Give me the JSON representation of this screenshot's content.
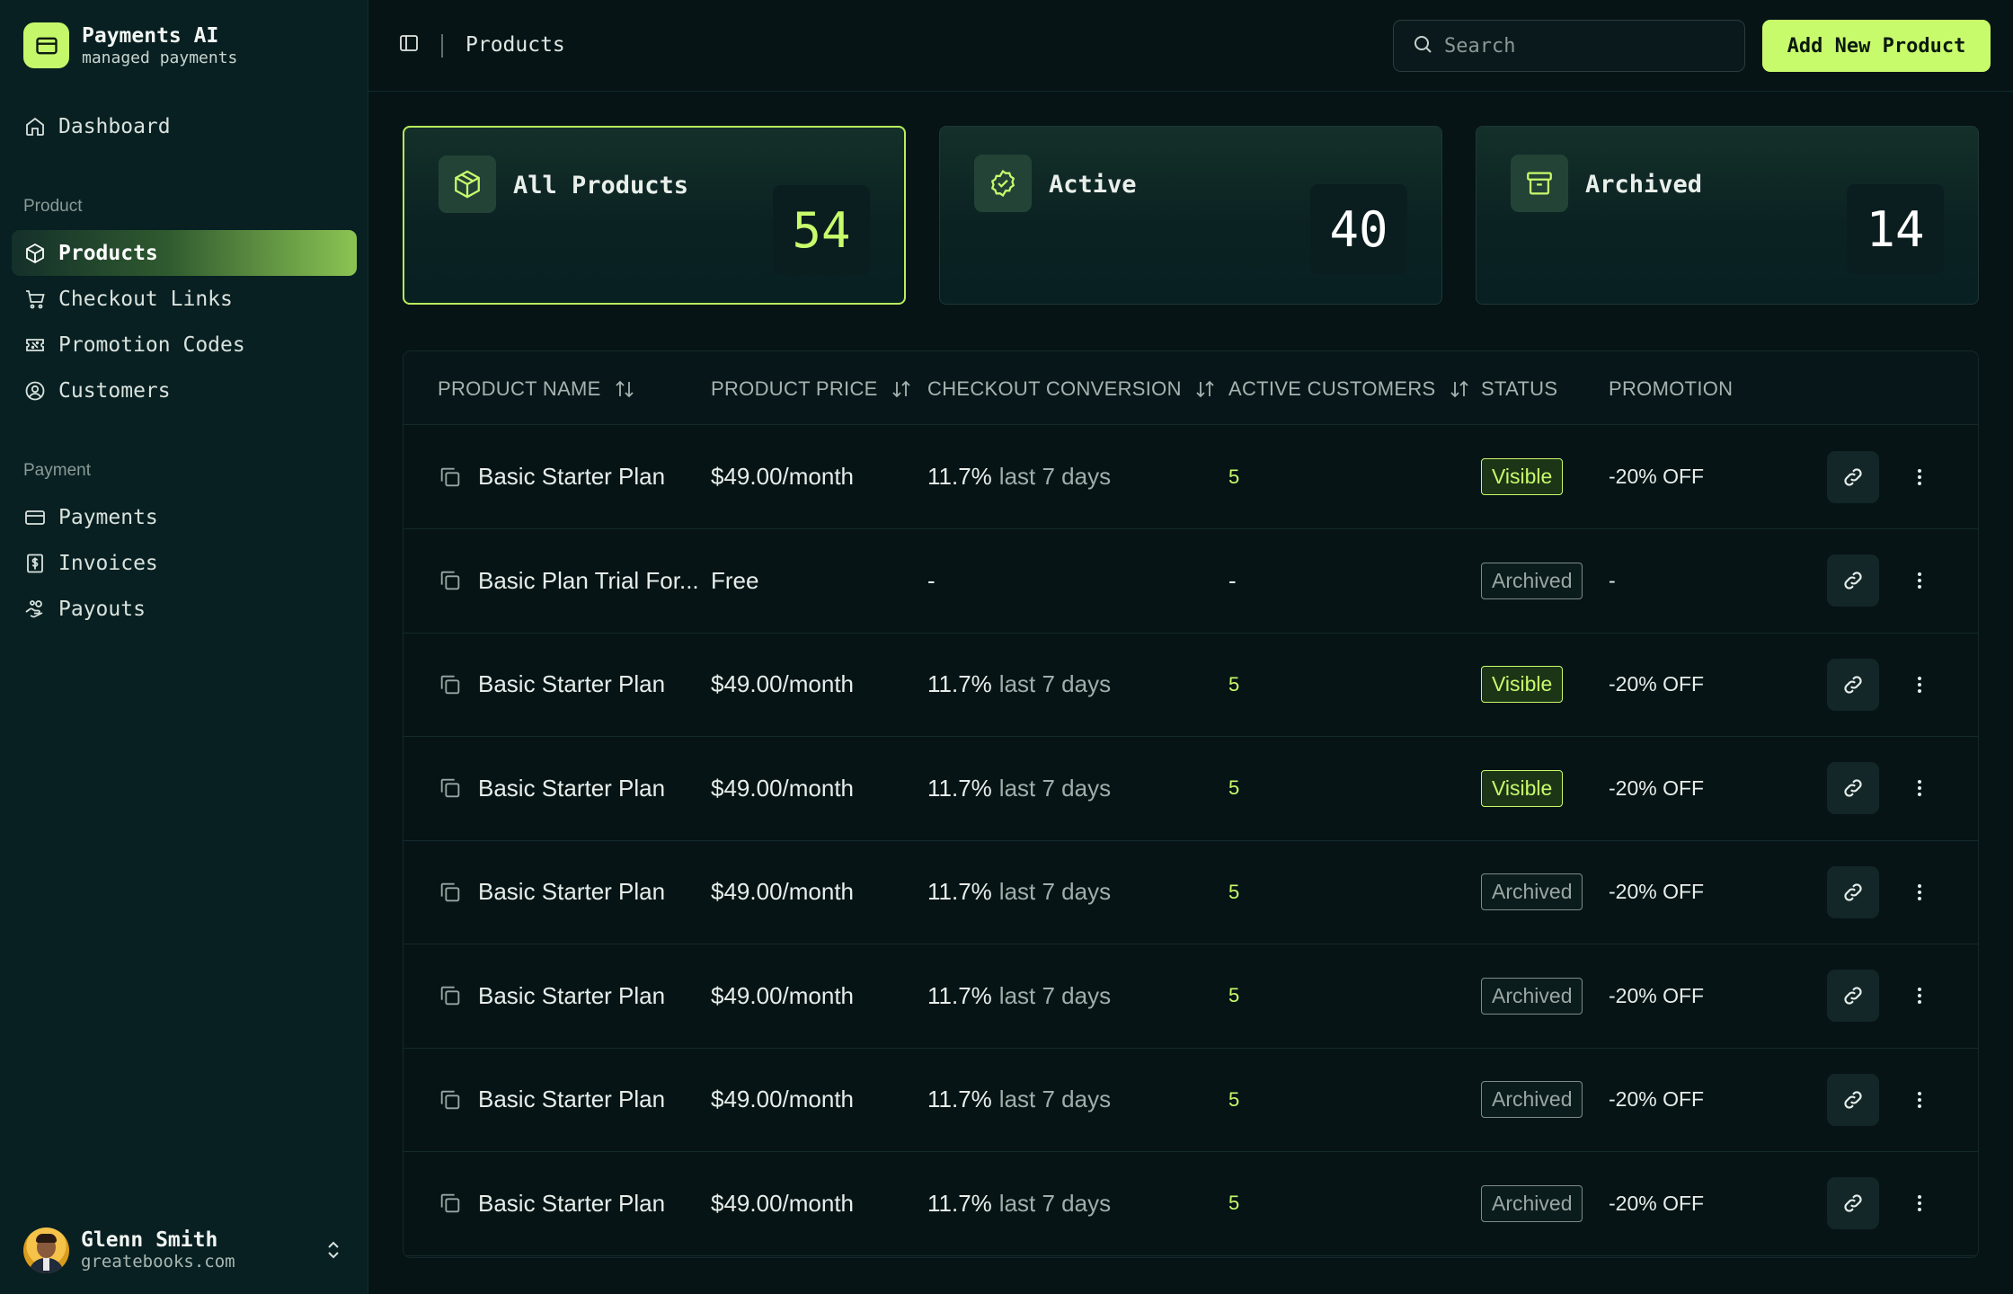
{
  "brand": {
    "title": "Payments AI",
    "subtitle": "managed payments"
  },
  "nav": {
    "dashboard": "Dashboard",
    "product_section": "Product",
    "products": "Products",
    "checkout_links": "Checkout Links",
    "promotion_codes": "Promotion Codes",
    "customers": "Customers",
    "payment_section": "Payment",
    "payments": "Payments",
    "invoices": "Invoices",
    "payouts": "Payouts"
  },
  "user": {
    "name": "Glenn Smith",
    "email": "greatebooks.com"
  },
  "topbar": {
    "breadcrumb": "Products",
    "search_placeholder": "Search",
    "add_button": "Add New Product"
  },
  "stats": [
    {
      "title": "All Products",
      "value": "54",
      "color": "#c8fb6c"
    },
    {
      "title": "Active",
      "value": "40",
      "color": "#ffffff"
    },
    {
      "title": "Archived",
      "value": "14",
      "color": "#ffffff"
    }
  ],
  "table": {
    "columns": {
      "name": "PRODUCT NAME",
      "price": "PRODUCT PRICE",
      "conversion": "CHECKOUT CONVERSION",
      "customers": "ACTIVE CUSTOMERS",
      "status": "STATUS",
      "promotion": "PROMOTION"
    },
    "rows": [
      {
        "name": "Basic Starter Plan",
        "price": "$49.00/month",
        "conversion": "11.7%",
        "conversion_period": "last 7 days",
        "customers": "5",
        "status": "Visible",
        "promotion": "-20% OFF"
      },
      {
        "name": "Basic Plan Trial For...",
        "price": "Free",
        "conversion": "-",
        "conversion_period": "",
        "customers": "-",
        "status": "Archived",
        "promotion": "-"
      },
      {
        "name": "Basic Starter Plan",
        "price": "$49.00/month",
        "conversion": "11.7%",
        "conversion_period": "last 7 days",
        "customers": "5",
        "status": "Visible",
        "promotion": "-20% OFF"
      },
      {
        "name": "Basic Starter Plan",
        "price": "$49.00/month",
        "conversion": "11.7%",
        "conversion_period": "last 7 days",
        "customers": "5",
        "status": "Visible",
        "promotion": "-20% OFF"
      },
      {
        "name": "Basic Starter Plan",
        "price": "$49.00/month",
        "conversion": "11.7%",
        "conversion_period": "last 7 days",
        "customers": "5",
        "status": "Archived",
        "promotion": "-20% OFF"
      },
      {
        "name": "Basic Starter Plan",
        "price": "$49.00/month",
        "conversion": "11.7%",
        "conversion_period": "last 7 days",
        "customers": "5",
        "status": "Archived",
        "promotion": "-20% OFF"
      },
      {
        "name": "Basic Starter Plan",
        "price": "$49.00/month",
        "conversion": "11.7%",
        "conversion_period": "last 7 days",
        "customers": "5",
        "status": "Archived",
        "promotion": "-20% OFF"
      },
      {
        "name": "Basic Starter Plan",
        "price": "$49.00/month",
        "conversion": "11.7%",
        "conversion_period": "last 7 days",
        "customers": "5",
        "status": "Archived",
        "promotion": "-20% OFF"
      }
    ]
  }
}
